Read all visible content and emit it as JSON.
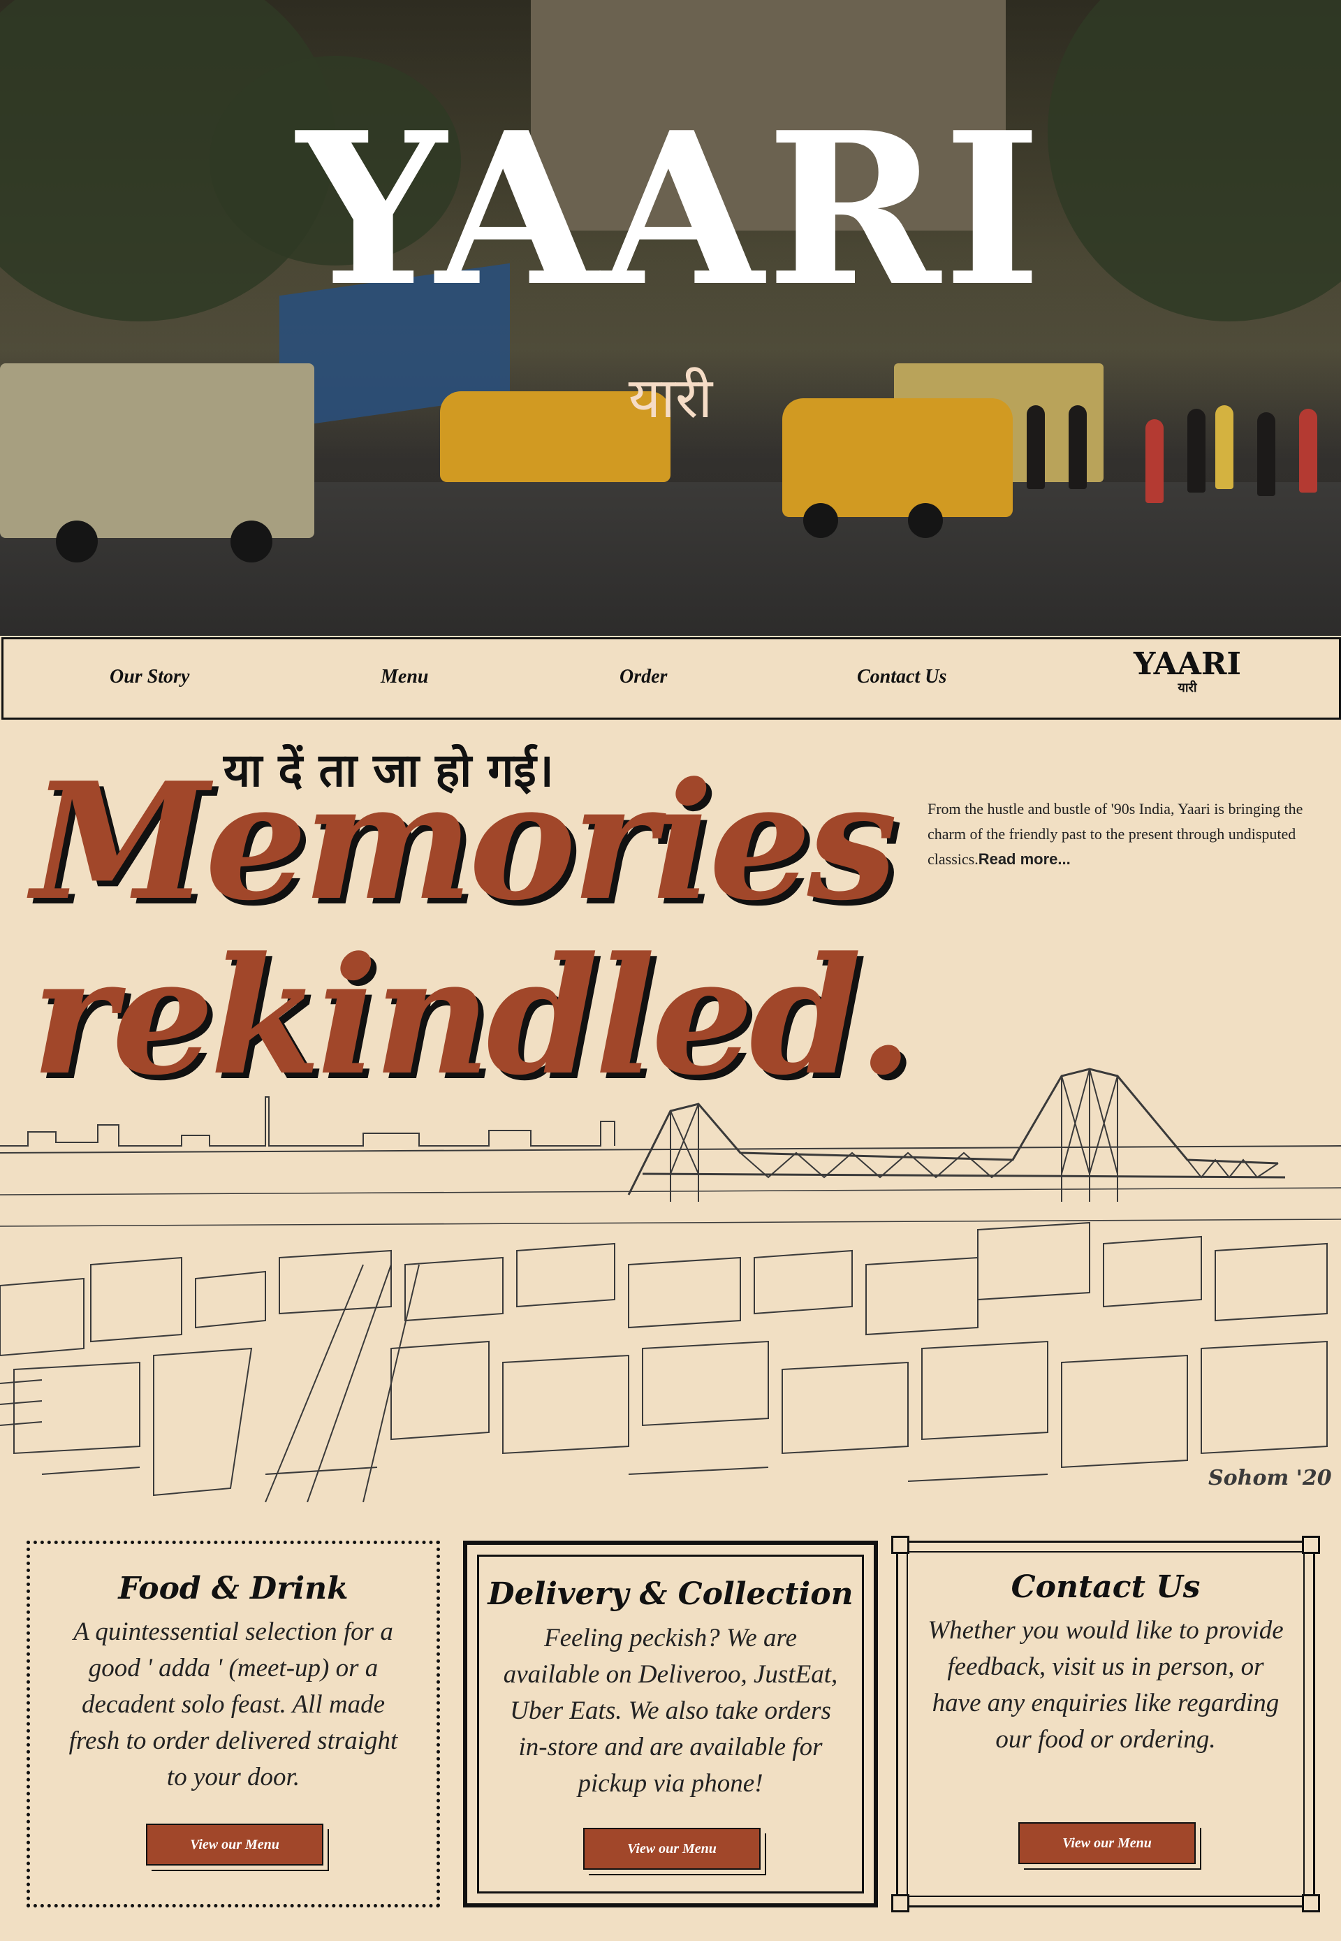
{
  "hero": {
    "title": "YAARI",
    "subtitle": "यारी"
  },
  "nav": {
    "items": [
      "Our Story",
      "Menu",
      "Order",
      "Contact Us"
    ],
    "logo_title": "YAARI",
    "logo_subtitle": "यारी"
  },
  "headline": {
    "hindi": "या दें ता जा हो गई।",
    "line1": "Memories",
    "line2": "rekindled.",
    "intro": "From the hustle and bustle of '90s India, Yaari is bringing the charm of the friendly past to the present through undisputed classics.",
    "read_more": "Read more..."
  },
  "sketch": {
    "signature": "Sohom '20"
  },
  "cards": [
    {
      "title": "Food & Drink",
      "text": "A quintessential selection for a good ' adda ' (meet-up) or a decadent solo feast. All made fresh to order delivered straight to your door.",
      "button": "View our Menu"
    },
    {
      "title": "Delivery & Collection",
      "text": "Feeling peckish? We are available on Deliveroo, JustEat, Uber Eats. We also take orders in-store and are available for pickup via phone!",
      "button": "View our Menu"
    },
    {
      "title": "Contact Us",
      "text": "Whether you would like to provide feedback, visit us in person, or have any enquiries like regarding our food or ordering.",
      "button": "View our Menu"
    }
  ],
  "colors": {
    "background": "#f1dfc3",
    "accent": "#a1472a",
    "ink": "#111111"
  }
}
